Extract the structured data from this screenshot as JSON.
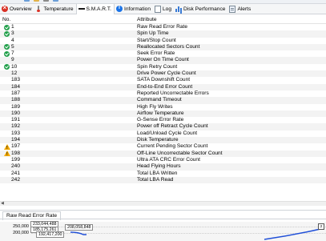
{
  "tabs": [
    {
      "label": "Overview",
      "icon": "error-icon"
    },
    {
      "label": "Temperature",
      "icon": "thermometer-icon"
    },
    {
      "label": "S.M.A.R.T.",
      "icon": "smart-icon"
    },
    {
      "label": "Information",
      "icon": "info-icon"
    },
    {
      "label": "Log",
      "icon": "log-icon"
    },
    {
      "label": "Disk Performance",
      "icon": "performance-icon"
    },
    {
      "label": "Alerts",
      "icon": "alerts-icon"
    }
  ],
  "active_tab": "S.M.A.R.T.",
  "columns": {
    "no": "No.",
    "attribute": "Attribute"
  },
  "rows": [
    {
      "no": "1",
      "attribute": "Raw Read Error Rate",
      "status": "ok"
    },
    {
      "no": "3",
      "attribute": "Spin Up Time",
      "status": "ok"
    },
    {
      "no": "4",
      "attribute": "Start/Stop Count",
      "status": "none"
    },
    {
      "no": "5",
      "attribute": "Reallocated Sectors Count",
      "status": "ok"
    },
    {
      "no": "7",
      "attribute": "Seek Error Rate",
      "status": "ok"
    },
    {
      "no": "9",
      "attribute": "Power On Time Count",
      "status": "none"
    },
    {
      "no": "10",
      "attribute": "Spin Retry Count",
      "status": "ok"
    },
    {
      "no": "12",
      "attribute": "Drive Power Cycle Count",
      "status": "none"
    },
    {
      "no": "183",
      "attribute": "SATA Downshift Count",
      "status": "none"
    },
    {
      "no": "184",
      "attribute": "End-to-End Error Count",
      "status": "none"
    },
    {
      "no": "187",
      "attribute": "Reported Uncorrectable Errors",
      "status": "none"
    },
    {
      "no": "188",
      "attribute": "Command Timeout",
      "status": "none"
    },
    {
      "no": "189",
      "attribute": "High Fly Writes",
      "status": "none"
    },
    {
      "no": "190",
      "attribute": "Airflow Temperature",
      "status": "none"
    },
    {
      "no": "191",
      "attribute": "G-Sense Error Rate",
      "status": "none"
    },
    {
      "no": "192",
      "attribute": "Power off Retract Cycle Count",
      "status": "none"
    },
    {
      "no": "193",
      "attribute": "Load/Unload Cycle Count",
      "status": "none"
    },
    {
      "no": "194",
      "attribute": "Disk Temperature",
      "status": "none"
    },
    {
      "no": "197",
      "attribute": "Current Pending Sector Count",
      "status": "warn"
    },
    {
      "no": "198",
      "attribute": "Off-Line Uncorrectable Sector Count",
      "status": "warn"
    },
    {
      "no": "199",
      "attribute": "Ultra ATA CRC Error Count",
      "status": "none"
    },
    {
      "no": "240",
      "attribute": "Head Flying Hours",
      "status": "none"
    },
    {
      "no": "241",
      "attribute": "Total LBA Written",
      "status": "none"
    },
    {
      "no": "242",
      "attribute": "Total LBA Read",
      "status": "none"
    }
  ],
  "lower_panel": {
    "tab_label": "Raw Read Error Rate",
    "y_ticks": [
      "250,000",
      "200,000"
    ],
    "tooltips": [
      "233,044,488",
      "185,175,261",
      "208,058,848",
      "192,417,200"
    ]
  },
  "colors": {
    "ok": "#22a04b",
    "warn": "#f2a900",
    "error": "#d93025",
    "curve": "#1f4fd8"
  }
}
